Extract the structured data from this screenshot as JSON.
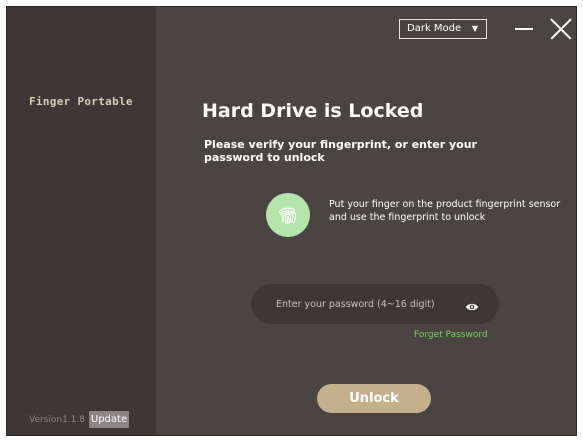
{
  "sidebar": {
    "app_name": "Finger Portable",
    "version": "Version1.1.8",
    "update_label": "Update"
  },
  "titlebar": {
    "mode_selected": "Dark Mode",
    "mode_caret": "▼"
  },
  "main": {
    "title": "Hard Drive is Locked",
    "subtitle": "Please verify your fingerprint, or enter your password to unlock",
    "fingerprint_instruction": "Put your finger on the product fingerprint sensor and use the fingerprint to unlock",
    "password_placeholder": "Enter your password (4~16 digit)",
    "forgot_label": "Forget Password",
    "unlock_label": "Unlock"
  },
  "icons": {
    "fingerprint": "fingerprint-icon",
    "eye": "eye-icon",
    "minimize": "minimize-icon",
    "close": "close-icon"
  },
  "colors": {
    "sidebar_bg": "#3d3835",
    "main_bg": "#4b4542",
    "accent_green": "#72d25c",
    "fingerprint_bg": "#b5e4aa",
    "unlock_bg": "#c5b08d",
    "app_name": "#d7cdb6"
  }
}
